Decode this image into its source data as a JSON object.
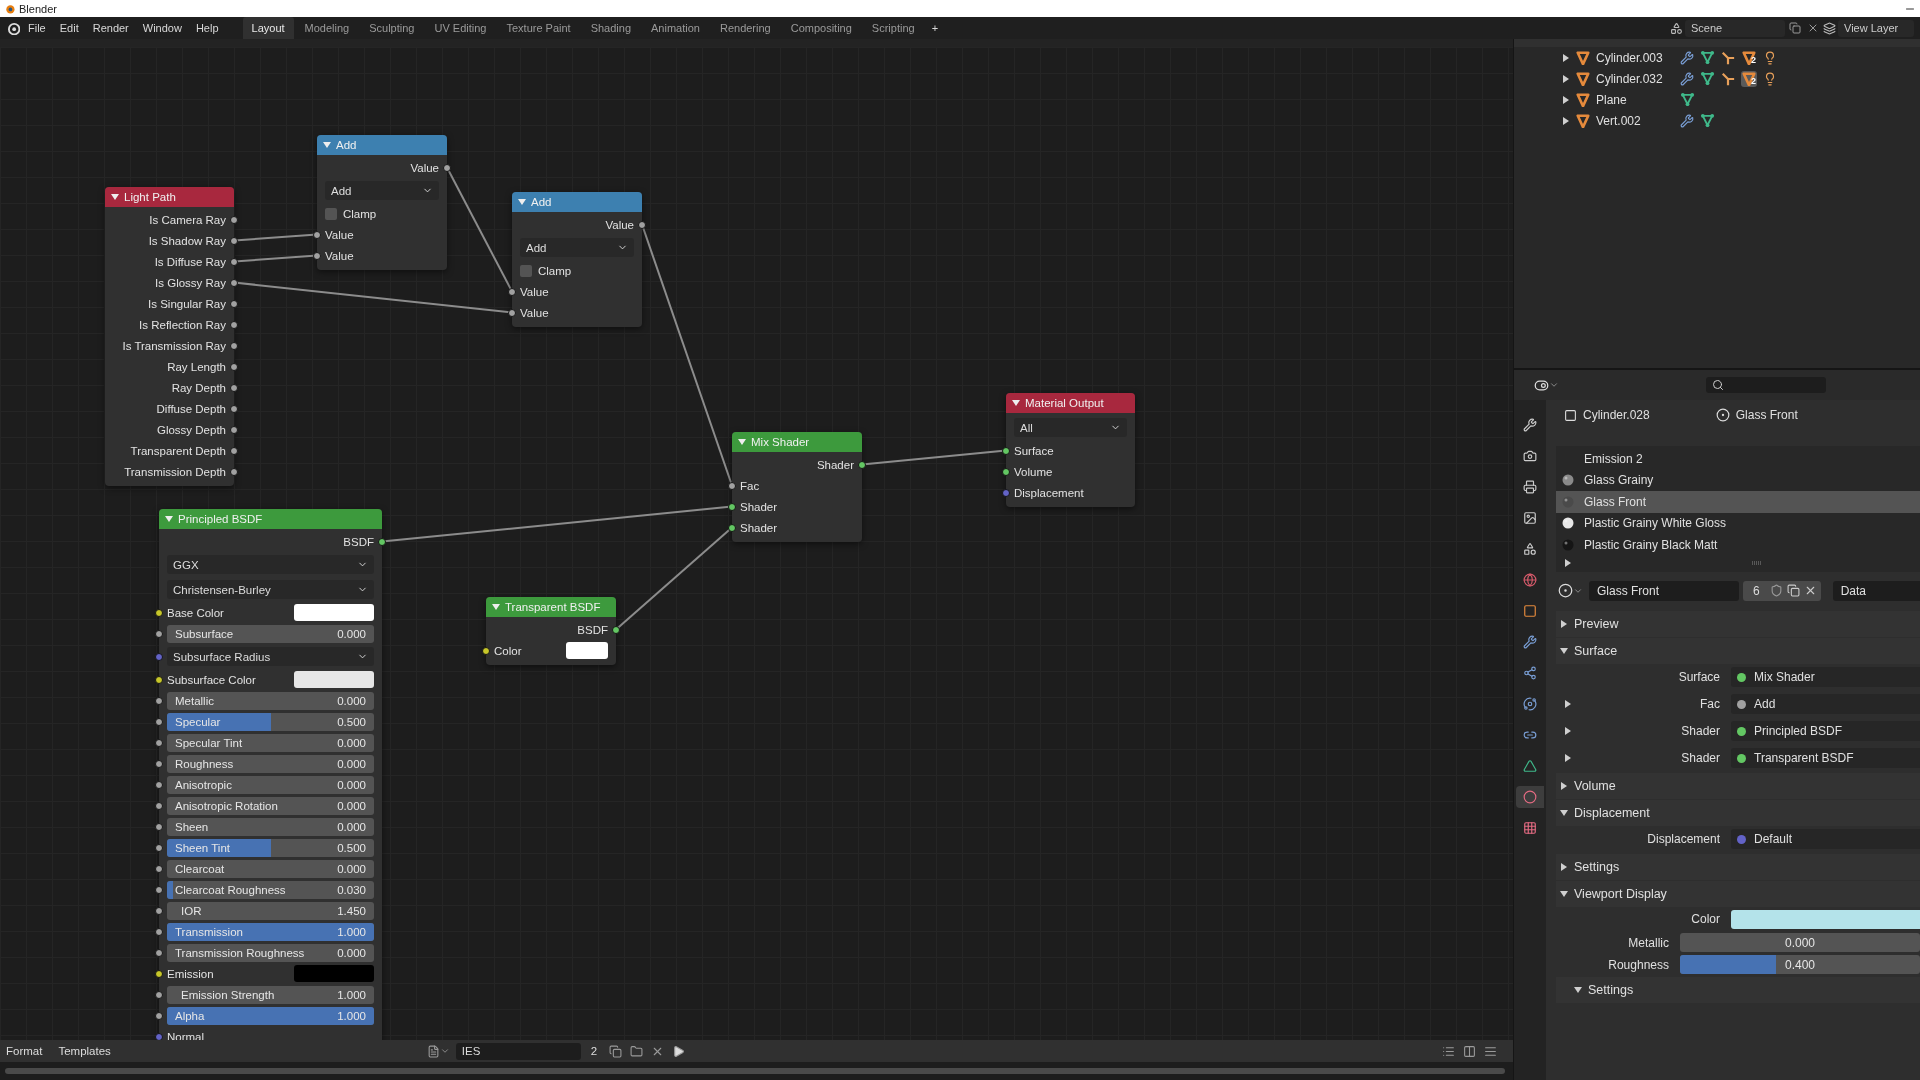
{
  "window": {
    "title": "Blender"
  },
  "menu": [
    "File",
    "Edit",
    "Render",
    "Window",
    "Help"
  ],
  "workspaces": [
    {
      "label": "Layout",
      "selected": true
    },
    {
      "label": "Modeling",
      "selected": false
    },
    {
      "label": "Sculpting",
      "selected": false
    },
    {
      "label": "UV Editing",
      "selected": false
    },
    {
      "label": "Texture Paint",
      "selected": false
    },
    {
      "label": "Shading",
      "selected": false
    },
    {
      "label": "Animation",
      "selected": false
    },
    {
      "label": "Rendering",
      "selected": false
    },
    {
      "label": "Compositing",
      "selected": false
    },
    {
      "label": "Scripting",
      "selected": false
    }
  ],
  "add_workspace": "+",
  "scene": {
    "name": "Scene",
    "view_layer": "View Layer"
  },
  "nodes": [
    {
      "title": "Add",
      "color": "#3d80b0",
      "rows": [
        {
          "kind": "output",
          "label": "Value",
          "socket": {
            "color": "#a1a1a1"
          }
        },
        {
          "kind": "select",
          "label": "Add"
        },
        {
          "kind": "checkbox",
          "label": "Clamp",
          "checked": false
        },
        {
          "kind": "input",
          "label": "Value",
          "socket": {
            "color": "#a1a1a1"
          }
        },
        {
          "kind": "input",
          "label": "Value",
          "socket": {
            "color": "#a1a1a1"
          }
        }
      ]
    },
    {
      "title": "Light Path",
      "color": "#a8283e",
      "rows": [
        {
          "kind": "output",
          "label": "Is Camera Ray",
          "socket": {
            "color": "#a1a1a1"
          }
        },
        {
          "kind": "output",
          "label": "Is Shadow Ray",
          "socket": {
            "color": "#a1a1a1"
          }
        },
        {
          "kind": "output",
          "label": "Is Diffuse Ray",
          "socket": {
            "color": "#a1a1a1"
          }
        },
        {
          "kind": "output",
          "label": "Is Glossy Ray",
          "socket": {
            "color": "#a1a1a1"
          }
        },
        {
          "kind": "output",
          "label": "Is Singular Ray",
          "socket": {
            "color": "#a1a1a1"
          }
        },
        {
          "kind": "output",
          "label": "Is Reflection Ray",
          "socket": {
            "color": "#a1a1a1"
          }
        },
        {
          "kind": "output",
          "label": "Is Transmission Ray",
          "socket": {
            "color": "#a1a1a1"
          }
        },
        {
          "kind": "output",
          "label": "Ray Length",
          "socket": {
            "color": "#a1a1a1"
          }
        },
        {
          "kind": "output",
          "label": "Ray Depth",
          "socket": {
            "color": "#a1a1a1"
          }
        },
        {
          "kind": "output",
          "label": "Diffuse Depth",
          "socket": {
            "color": "#a1a1a1"
          }
        },
        {
          "kind": "output",
          "label": "Glossy Depth",
          "socket": {
            "color": "#a1a1a1"
          }
        },
        {
          "kind": "output",
          "label": "Transparent Depth",
          "socket": {
            "color": "#a1a1a1"
          }
        },
        {
          "kind": "output",
          "label": "Transmission Depth",
          "socket": {
            "color": "#a1a1a1"
          }
        }
      ]
    },
    {
      "title": "Add",
      "color": "#3d80b0",
      "rows": [
        {
          "kind": "output",
          "label": "Value",
          "socket": {
            "color": "#a1a1a1"
          }
        },
        {
          "kind": "select",
          "label": "Add"
        },
        {
          "kind": "checkbox",
          "label": "Clamp",
          "checked": false
        },
        {
          "kind": "input",
          "label": "Value",
          "socket": {
            "color": "#a1a1a1"
          }
        },
        {
          "kind": "input",
          "label": "Value",
          "socket": {
            "color": "#a1a1a1"
          }
        }
      ]
    },
    {
      "title": "Material Output",
      "color": "#a8283e",
      "rows": [
        {
          "kind": "select",
          "label": "All"
        },
        {
          "kind": "input",
          "label": "Surface",
          "socket": {
            "color": "#63c763"
          }
        },
        {
          "kind": "input",
          "label": "Volume",
          "socket": {
            "color": "#63c763"
          }
        },
        {
          "kind": "input",
          "label": "Displacement",
          "socket": {
            "color": "#6363c7"
          }
        }
      ]
    },
    {
      "title": "Mix Shader",
      "color": "#3d9a3d",
      "rows": [
        {
          "kind": "output",
          "label": "Shader",
          "socket": {
            "color": "#63c763"
          }
        },
        {
          "kind": "input",
          "label": "Fac",
          "socket": {
            "color": "#a1a1a1"
          }
        },
        {
          "kind": "input",
          "label": "Shader",
          "socket": {
            "color": "#63c763"
          }
        },
        {
          "kind": "input",
          "label": "Shader",
          "socket": {
            "color": "#63c763"
          }
        }
      ]
    },
    {
      "title": "Principled BSDF",
      "color": "#3d9a3d",
      "rows": [
        {
          "kind": "output",
          "label": "BSDF",
          "socket": {
            "color": "#63c763"
          }
        },
        {
          "kind": "select",
          "label": "GGX"
        },
        {
          "kind": "select",
          "label": "Christensen-Burley"
        },
        {
          "kind": "color",
          "label": "Base Color",
          "socket": {
            "color": "#c7c729"
          },
          "color": "#ffffff"
        },
        {
          "kind": "slider",
          "label": "Subsurface",
          "value": "0.000",
          "level": 0,
          "socket": {
            "color": "#a1a1a1"
          }
        },
        {
          "kind": "select",
          "label": "Subsurface Radius",
          "socket": {
            "color": "#6363c7"
          }
        },
        {
          "kind": "color",
          "label": "Subsurface Color",
          "socket": {
            "color": "#c7c729"
          },
          "color": "#e6e6e6"
        },
        {
          "kind": "slider",
          "label": "Metallic",
          "value": "0.000",
          "level": 0,
          "socket": {
            "color": "#a1a1a1"
          }
        },
        {
          "kind": "slider",
          "label": "Specular",
          "value": "0.500",
          "level": 0.5,
          "socket": {
            "color": "#a1a1a1"
          }
        },
        {
          "kind": "slider",
          "label": "Specular Tint",
          "value": "0.000",
          "level": 0,
          "socket": {
            "color": "#a1a1a1"
          }
        },
        {
          "kind": "slider",
          "label": "Roughness",
          "value": "0.000",
          "level": 0,
          "socket": {
            "color": "#a1a1a1"
          }
        },
        {
          "kind": "slider",
          "label": "Anisotropic",
          "value": "0.000",
          "level": 0,
          "socket": {
            "color": "#a1a1a1"
          }
        },
        {
          "kind": "slider",
          "label": "Anisotropic Rotation",
          "value": "0.000",
          "level": 0,
          "socket": {
            "color": "#a1a1a1"
          }
        },
        {
          "kind": "slider",
          "label": "Sheen",
          "value": "0.000",
          "level": 0,
          "socket": {
            "color": "#a1a1a1"
          }
        },
        {
          "kind": "slider",
          "label": "Sheen Tint",
          "value": "0.500",
          "level": 0.5,
          "socket": {
            "color": "#a1a1a1"
          }
        },
        {
          "kind": "slider",
          "label": "Clearcoat",
          "value": "0.000",
          "level": 0,
          "socket": {
            "color": "#a1a1a1"
          }
        },
        {
          "kind": "slider",
          "label": "Clearcoat Roughness",
          "value": "0.030",
          "level": 0.03,
          "socket": {
            "color": "#a1a1a1"
          }
        },
        {
          "kind": "number",
          "label": "IOR",
          "value": "1.450",
          "socket": {
            "color": "#a1a1a1"
          }
        },
        {
          "kind": "slider",
          "label": "Transmission",
          "value": "1.000",
          "level": 1,
          "socket": {
            "color": "#a1a1a1"
          }
        },
        {
          "kind": "slider",
          "label": "Transmission Roughness",
          "value": "0.000",
          "level": 0,
          "socket": {
            "color": "#a1a1a1"
          }
        },
        {
          "kind": "color",
          "label": "Emission",
          "socket": {
            "color": "#c7c729"
          },
          "color": "#000000"
        },
        {
          "kind": "number",
          "label": "Emission Strength",
          "value": "1.000",
          "socket": {
            "color": "#a1a1a1"
          }
        },
        {
          "kind": "slider",
          "label": "Alpha",
          "value": "1.000",
          "level": 1,
          "socket": {
            "color": "#a1a1a1"
          }
        },
        {
          "kind": "input",
          "label": "Normal",
          "socket": {
            "color": "#6363c7"
          }
        }
      ]
    },
    {
      "title": "Transparent BSDF",
      "color": "#3d9a3d",
      "rows": [
        {
          "kind": "output",
          "label": "BSDF",
          "socket": {
            "color": "#63c763"
          }
        },
        {
          "kind": "color",
          "label": "Color",
          "socket": {
            "color": "#c7c729"
          },
          "color": "#ffffff"
        }
      ]
    }
  ],
  "outliner": {
    "rows": [
      {
        "name": "Cylinder.003",
        "icons": [
          {
            "kind": "wrench"
          },
          {
            "kind": "mesh"
          },
          {
            "kind": "armature"
          },
          {
            "kind": "material",
            "count": "2",
            "selected": false
          },
          {
            "kind": "light"
          }
        ]
      },
      {
        "name": "Cylinder.032",
        "icons": [
          {
            "kind": "wrench"
          },
          {
            "kind": "mesh"
          },
          {
            "kind": "armature"
          },
          {
            "kind": "material",
            "count": "2",
            "selected": true
          },
          {
            "kind": "light"
          }
        ]
      },
      {
        "name": "Plane",
        "icons": [
          {
            "kind": "mesh"
          }
        ]
      },
      {
        "name": "Vert.002",
        "icons": [
          {
            "kind": "wrench"
          },
          {
            "kind": "mesh"
          }
        ]
      }
    ]
  },
  "properties": {
    "tabs": [
      {
        "kind": "tool",
        "selected": false
      },
      {
        "kind": "render",
        "selected": false
      },
      {
        "kind": "output",
        "selected": false
      },
      {
        "kind": "view",
        "selected": false
      },
      {
        "kind": "scene",
        "selected": false
      },
      {
        "kind": "world",
        "selected": false
      },
      {
        "kind": "object",
        "selected": false
      },
      {
        "kind": "modifier",
        "selected": false
      },
      {
        "kind": "particles",
        "selected": false
      },
      {
        "kind": "physics",
        "selected": false
      },
      {
        "kind": "constraint",
        "selected": false
      },
      {
        "kind": "data",
        "selected": false
      },
      {
        "kind": "material",
        "selected": true
      },
      {
        "kind": "texture",
        "selected": false
      }
    ],
    "breadcrumb": {
      "object": "Cylinder.028",
      "material": "Glass Front"
    },
    "slots": [
      {
        "name": "Emission 2",
        "kind": "none",
        "selected": false
      },
      {
        "name": "Glass Grainy",
        "kind": "glass",
        "selected": false
      },
      {
        "name": "Glass Front",
        "kind": "dark",
        "selected": true
      },
      {
        "name": "Plastic Grainy White Gloss",
        "kind": "white",
        "selected": false
      },
      {
        "name": "Plastic Grainy Black Matt",
        "kind": "black",
        "selected": false
      }
    ],
    "material": {
      "name": "Glass Front",
      "users": "6",
      "link": "Data"
    },
    "panels": [
      {
        "title": "Preview",
        "expanded": false
      },
      {
        "title": "Surface",
        "expanded": true,
        "rows": [
          {
            "kind": "link",
            "label": "Surface",
            "value": "Mix Shader",
            "color": "#63c763",
            "expandable": false
          },
          {
            "kind": "link",
            "label": "Fac",
            "value": "Add",
            "color": "#a1a1a1",
            "expandable": true
          },
          {
            "kind": "link",
            "label": "Shader",
            "value": "Principled BSDF",
            "color": "#63c763",
            "expandable": true
          },
          {
            "kind": "link",
            "label": "Shader",
            "value": "Transparent BSDF",
            "color": "#63c763",
            "expandable": true
          }
        ]
      },
      {
        "title": "Volume",
        "expanded": false
      },
      {
        "title": "Displacement",
        "expanded": true,
        "rows": [
          {
            "kind": "link",
            "label": "Displacement",
            "value": "Default",
            "color": "#6363c7",
            "expandable": false
          }
        ]
      },
      {
        "title": "Settings",
        "expanded": false
      },
      {
        "title": "Viewport Display",
        "expanded": true,
        "rows": [
          {
            "kind": "color",
            "label": "Color",
            "color": "#b4e3ea"
          },
          {
            "kind": "slider",
            "label": "Metallic",
            "value": "0.000",
            "level": 0
          },
          {
            "kind": "slider",
            "label": "Roughness",
            "value": "0.400",
            "level": 0.4
          }
        ],
        "subpanels": [
          {
            "title": "Settings",
            "expanded": true
          }
        ]
      }
    ]
  },
  "text_editor": {
    "menu": [
      "Format",
      "Templates"
    ],
    "file": "IES",
    "users": "2"
  }
}
